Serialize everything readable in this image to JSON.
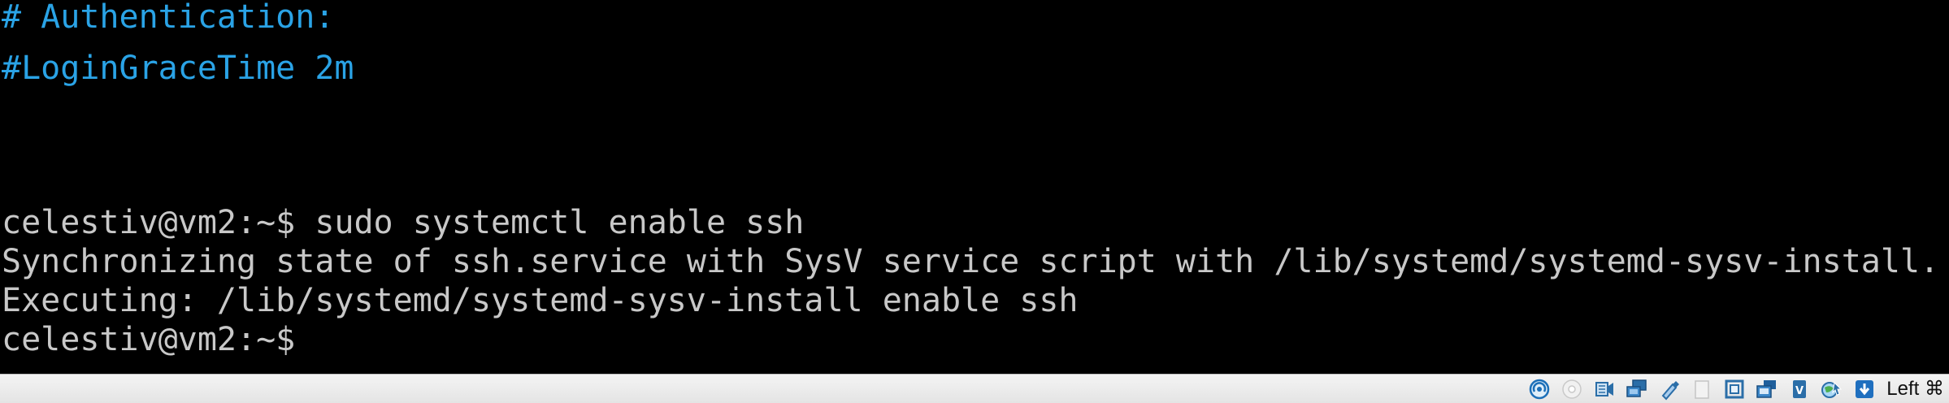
{
  "terminal": {
    "lines": [
      {
        "text": "# Authentication:",
        "kind": "comment"
      },
      {
        "text": "#LoginGraceTime 2m",
        "kind": "comment"
      },
      {
        "text": "celestiv@vm2:~$ sudo systemctl enable ssh",
        "kind": "plain"
      },
      {
        "text": "Synchronizing state of ssh.service with SysV service script with /lib/systemd/systemd-sysv-install.",
        "kind": "plain"
      },
      {
        "text": "Executing: /lib/systemd/systemd-sysv-install enable ssh",
        "kind": "plain"
      },
      {
        "text": "celestiv@vm2:~$",
        "kind": "plain"
      }
    ],
    "colors": {
      "background": "#000000",
      "comment": "#2aa3e6",
      "text": "#c8c8c8"
    }
  },
  "statusbar": {
    "host_key": "Left ⌘",
    "icons": [
      "hard-disk-icon",
      "optical-drive-icon",
      "audio-icon",
      "network-icon",
      "usb-icon",
      "shared-folders-icon",
      "display-icon",
      "recording-icon",
      "cpu-virtualization-icon",
      "mouse-integration-icon",
      "keyboard-capture-icon"
    ]
  }
}
